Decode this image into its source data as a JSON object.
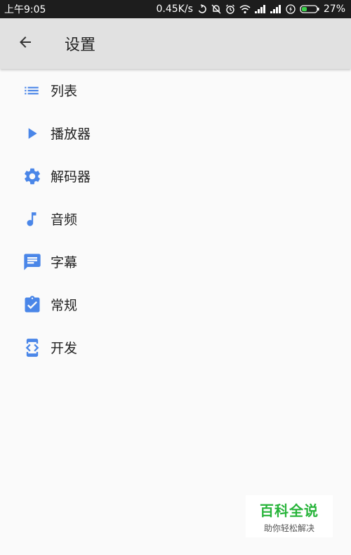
{
  "status_bar": {
    "time": "上午9:05",
    "net_speed": "0.45K/s",
    "battery": "27%"
  },
  "header": {
    "title": "设置"
  },
  "colors": {
    "accent": "#4a86e8",
    "app_bar": "#e1e1e1",
    "status_bar": "#1d1d1d"
  },
  "menu": {
    "items": [
      {
        "label": "列表",
        "icon": "list-icon"
      },
      {
        "label": "播放器",
        "icon": "play-icon"
      },
      {
        "label": "解码器",
        "icon": "gear-icon"
      },
      {
        "label": "音频",
        "icon": "music-note-icon"
      },
      {
        "label": "字幕",
        "icon": "subtitle-icon"
      },
      {
        "label": "常规",
        "icon": "clipboard-check-icon"
      },
      {
        "label": "开发",
        "icon": "developer-mode-icon"
      }
    ]
  },
  "watermark": {
    "logo": "百科全说",
    "tagline": "助你轻松解决"
  }
}
